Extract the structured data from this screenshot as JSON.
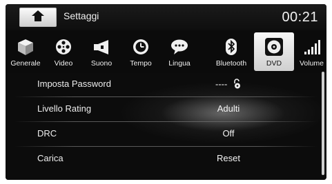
{
  "header": {
    "title": "Settaggi",
    "clock": "00:21"
  },
  "tabs": [
    {
      "label": "Generale",
      "icon": "cube-icon"
    },
    {
      "label": "Video",
      "icon": "film-reel-icon"
    },
    {
      "label": "Suono",
      "icon": "speaker-icon"
    },
    {
      "label": "Tempo",
      "icon": "clock-icon"
    },
    {
      "label": "Lingua",
      "icon": "speech-bubble-icon"
    },
    {
      "label": "Bluetooth",
      "icon": "bluetooth-icon"
    },
    {
      "label": "DVD",
      "icon": "disc-icon",
      "active": true
    },
    {
      "label": "Volume",
      "icon": "volume-bars-icon"
    }
  ],
  "settings": [
    {
      "label": "Imposta Password",
      "value": "----"
    },
    {
      "label": "Livello Rating",
      "value": "Adulti"
    },
    {
      "label": "DRC",
      "value": "Off"
    },
    {
      "label": "Carica",
      "value": "Reset"
    }
  ],
  "colors": {
    "background": "#0b0b0b",
    "active_tab": "#e8e8e8",
    "text": "#eeeeee"
  }
}
